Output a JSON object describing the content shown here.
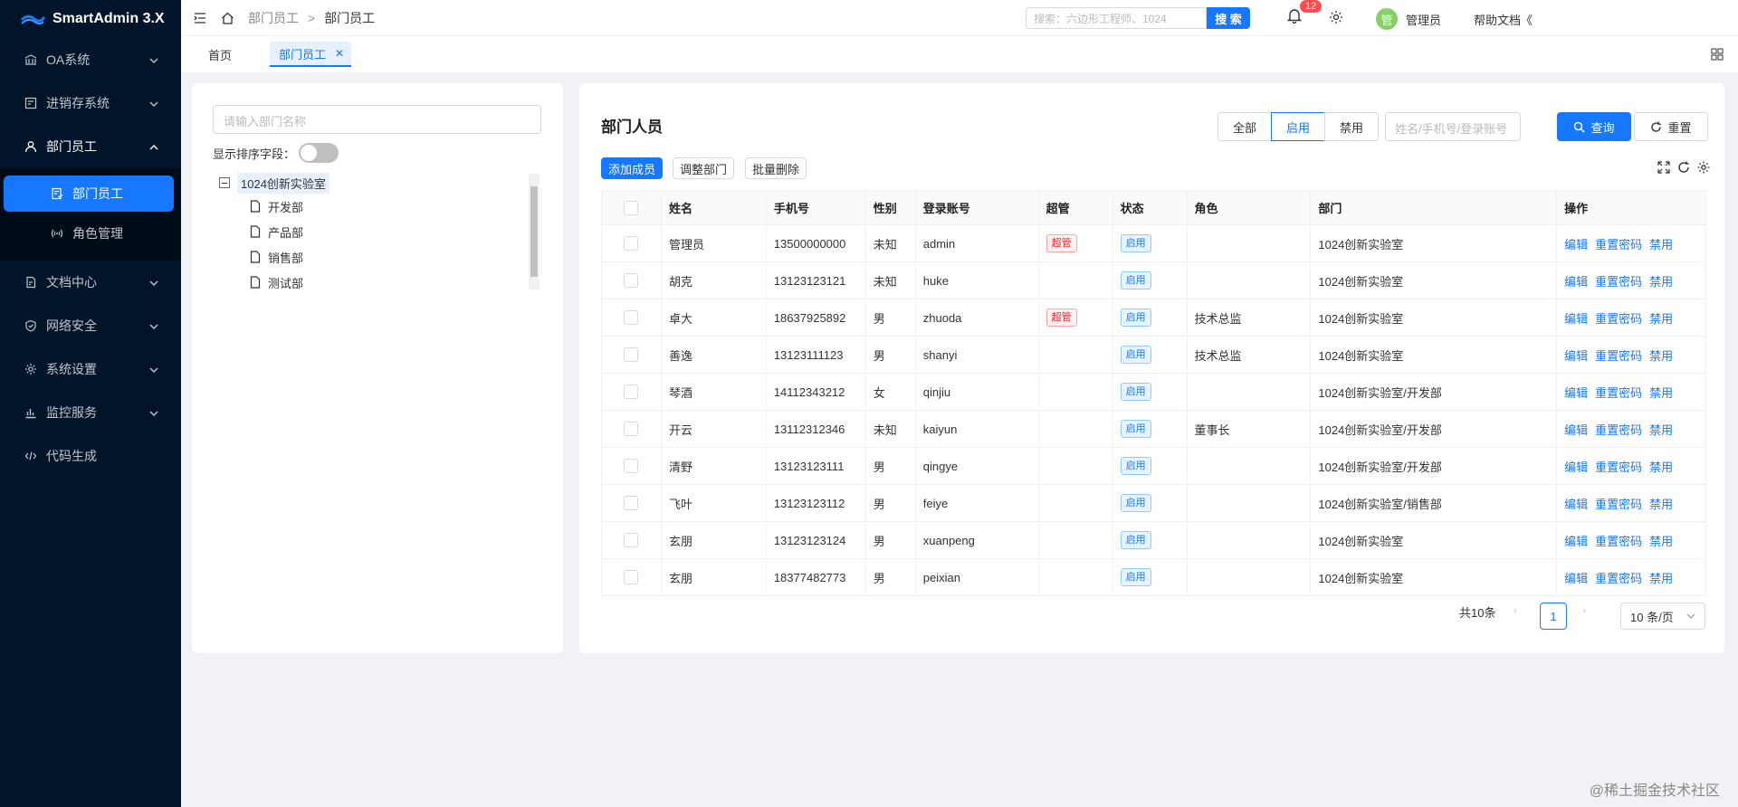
{
  "app": {
    "name": "SmartAdmin 3.X"
  },
  "sidebar": {
    "items": [
      {
        "label": "OA系统",
        "icon": "bank-icon"
      },
      {
        "label": "进销存系统",
        "icon": "inventory-icon"
      },
      {
        "label": "部门员工",
        "icon": "user-icon",
        "open": true,
        "children": [
          {
            "label": "部门员工",
            "icon": "audit-icon",
            "active": true
          },
          {
            "label": "角色管理",
            "icon": "wifi-icon"
          }
        ]
      },
      {
        "label": "文档中心",
        "icon": "doc-icon"
      },
      {
        "label": "网络安全",
        "icon": "shield-icon"
      },
      {
        "label": "系统设置",
        "icon": "gear-icon"
      },
      {
        "label": "监控服务",
        "icon": "chart-icon"
      },
      {
        "label": "代码生成",
        "icon": "code-icon"
      }
    ]
  },
  "header": {
    "breadcrumb": [
      "部门员工",
      "部门员工"
    ],
    "search_placeholder": "搜索：六边形工程师、1024",
    "search_btn": "搜 索",
    "notif_count": "12",
    "avatar_text": "管",
    "username": "管理员",
    "help": "帮助文档",
    "help_suffix": "《"
  },
  "tabs": {
    "home": "首页",
    "active": "部门员工"
  },
  "dept_panel": {
    "search_placeholder": "请输入部门名称",
    "sort_label": "显示排序字段：",
    "root": "1024创新实验室",
    "children": [
      "开发部",
      "产品部",
      "销售部",
      "测试部"
    ]
  },
  "members": {
    "title": "部门人员",
    "filter": {
      "all": "全部",
      "enabled": "启用",
      "disabled": "禁用"
    },
    "kw_placeholder": "姓名/手机号/登录账号",
    "query": "查询",
    "reset": "重置",
    "add": "添加成员",
    "adjust": "调整部门",
    "batch_delete": "批量删除",
    "columns": [
      "姓名",
      "手机号",
      "性别",
      "登录账号",
      "超管",
      "状态",
      "角色",
      "部门",
      "操作"
    ],
    "rows": [
      {
        "name": "管理员",
        "phone": "13500000000",
        "gender": "未知",
        "account": "admin",
        "super": "超管",
        "status": "启用",
        "role": "",
        "dept": "1024创新实验室"
      },
      {
        "name": "胡克",
        "phone": "13123123121",
        "gender": "未知",
        "account": "huke",
        "super": "",
        "status": "启用",
        "role": "",
        "dept": "1024创新实验室"
      },
      {
        "name": "卓大",
        "phone": "18637925892",
        "gender": "男",
        "account": "zhuoda",
        "super": "超管",
        "status": "启用",
        "role": "技术总监",
        "dept": "1024创新实验室"
      },
      {
        "name": "善逸",
        "phone": "13123111123",
        "gender": "男",
        "account": "shanyi",
        "super": "",
        "status": "启用",
        "role": "技术总监",
        "dept": "1024创新实验室"
      },
      {
        "name": "琴酒",
        "phone": "14112343212",
        "gender": "女",
        "account": "qinjiu",
        "super": "",
        "status": "启用",
        "role": "",
        "dept": "1024创新实验室/开发部"
      },
      {
        "name": "开云",
        "phone": "13112312346",
        "gender": "未知",
        "account": "kaiyun",
        "super": "",
        "status": "启用",
        "role": "董事长",
        "dept": "1024创新实验室/开发部"
      },
      {
        "name": "清野",
        "phone": "13123123111",
        "gender": "男",
        "account": "qingye",
        "super": "",
        "status": "启用",
        "role": "",
        "dept": "1024创新实验室/开发部"
      },
      {
        "name": "飞叶",
        "phone": "13123123112",
        "gender": "男",
        "account": "feiye",
        "super": "",
        "status": "启用",
        "role": "",
        "dept": "1024创新实验室/销售部"
      },
      {
        "name": "玄朋",
        "phone": "13123123124",
        "gender": "男",
        "account": "xuanpeng",
        "super": "",
        "status": "启用",
        "role": "",
        "dept": "1024创新实验室"
      },
      {
        "name": "玄朋",
        "phone": "18377482773",
        "gender": "男",
        "account": "peixian",
        "super": "",
        "status": "启用",
        "role": "",
        "dept": "1024创新实验室"
      }
    ],
    "actions": {
      "edit": "编辑",
      "reset_pwd": "重置密码",
      "disable": "禁用"
    },
    "pagination": {
      "total": "共10条",
      "current": "1",
      "page_size": "10 条/页"
    }
  },
  "footer_watermark": "@稀土掘金技术社区",
  "colors": {
    "primary": "#1677ff",
    "sidebar": "#001529",
    "danger": "#f5222d"
  }
}
